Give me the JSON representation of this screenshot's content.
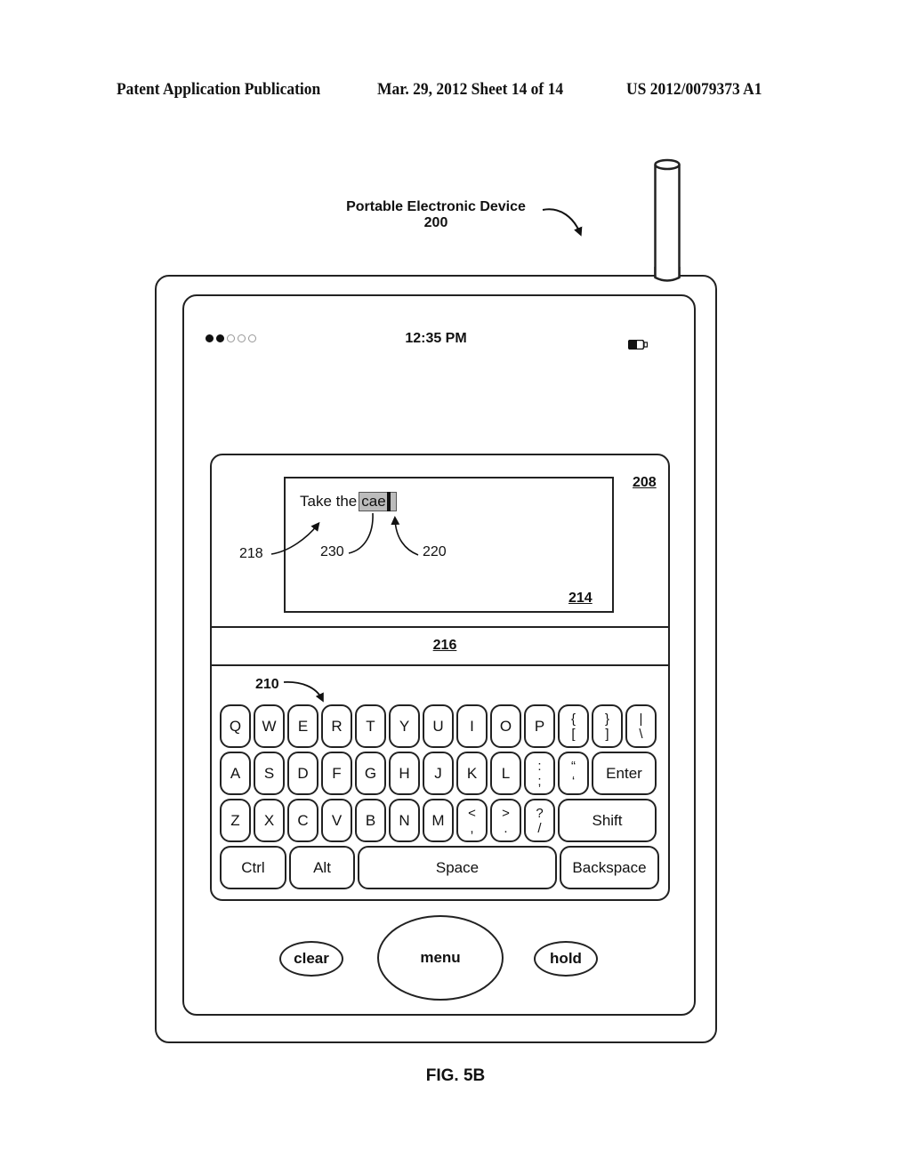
{
  "header": {
    "publication": "Patent Application Publication",
    "date_sheet": "Mar. 29, 2012  Sheet 14 of 14",
    "pub_number": "US 2012/0079373 A1"
  },
  "device": {
    "title": "Portable Electronic Device",
    "ref": "200",
    "status_bar": {
      "signal_dots_filled": 2,
      "signal_dots_total": 5,
      "time": "12:35 PM",
      "battery_icon": "battery-icon"
    },
    "panel_ref": "208",
    "text_area": {
      "ref": "214",
      "typed_prefix": "Take the",
      "highlighted_word": "cae"
    },
    "suggestion_bar_ref": "216",
    "callouts": {
      "text_ref": "218",
      "highlight_ref": "230",
      "cursor_ref": "220",
      "keyboard_ref": "210"
    },
    "keyboard": {
      "row1": [
        {
          "label": "Q"
        },
        {
          "label": "W"
        },
        {
          "label": "E"
        },
        {
          "label": "R"
        },
        {
          "label": "T"
        },
        {
          "label": "Y"
        },
        {
          "label": "U"
        },
        {
          "label": "I"
        },
        {
          "label": "O"
        },
        {
          "label": "P"
        },
        {
          "top": "{",
          "bottom": "["
        },
        {
          "top": "}",
          "bottom": "]"
        },
        {
          "top": "|",
          "bottom": "\\"
        }
      ],
      "row2": [
        {
          "label": "A"
        },
        {
          "label": "S"
        },
        {
          "label": "D"
        },
        {
          "label": "F"
        },
        {
          "label": "G"
        },
        {
          "label": "H"
        },
        {
          "label": "J"
        },
        {
          "label": "K"
        },
        {
          "label": "L"
        },
        {
          "top": ":",
          "bottom": ";"
        },
        {
          "top": "“",
          "bottom": "‘"
        },
        {
          "label": "Enter"
        }
      ],
      "row3": [
        {
          "label": "Z"
        },
        {
          "label": "X"
        },
        {
          "label": "C"
        },
        {
          "label": "V"
        },
        {
          "label": "B"
        },
        {
          "label": "N"
        },
        {
          "label": "M"
        },
        {
          "top": "<",
          "bottom": ","
        },
        {
          "top": ">",
          "bottom": "."
        },
        {
          "top": "?",
          "bottom": "/"
        },
        {
          "label": "Shift"
        }
      ],
      "row4": [
        {
          "label": "Ctrl"
        },
        {
          "label": "Alt"
        },
        {
          "label": "Space"
        },
        {
          "label": "Backspace"
        }
      ]
    },
    "buttons": {
      "clear": "clear",
      "menu": "menu",
      "hold": "hold"
    }
  },
  "figure_label": "FIG. 5B"
}
